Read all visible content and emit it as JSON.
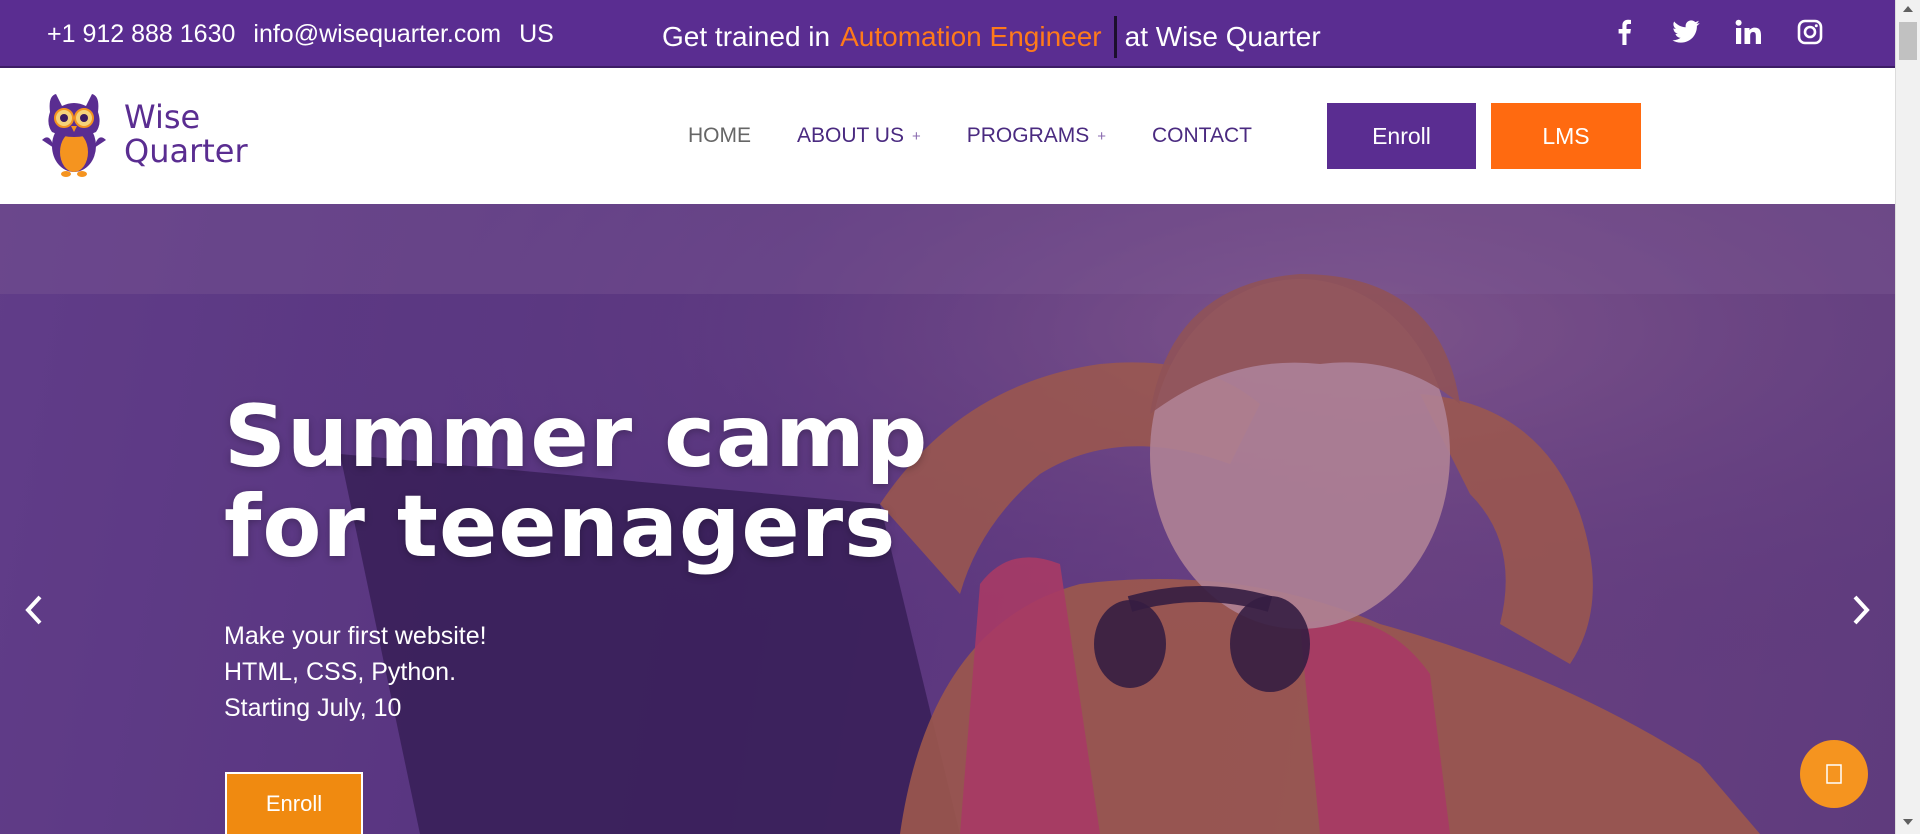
{
  "topbar": {
    "phone": "+1 912 888 1630",
    "email": "info@wisequarter.com",
    "region": "US",
    "promo_prefix": "Get trained in",
    "promo_highlight": "Automation Engineer",
    "promo_suffix": "at Wise Quarter",
    "highlight_color": "#ff7a1a",
    "social_icons": [
      "facebook-icon",
      "twitter-icon",
      "linkedin-icon",
      "instagram-icon"
    ]
  },
  "header": {
    "logo_line1": "Wise",
    "logo_line2": "Quarter",
    "nav": {
      "home": "HOME",
      "about": "ABOUT US",
      "programs": "PROGRAMS",
      "contact": "CONTACT",
      "expand_symbol": "+"
    },
    "enroll_label": "Enroll",
    "lms_label": "LMS"
  },
  "hero": {
    "title_line1": "Summer camp",
    "title_line2": "for teenagers",
    "sub_line1": "Make your first website!",
    "sub_line2": "HTML, CSS, Python.",
    "sub_line3": "Starting July, 10",
    "enroll_label": "Enroll"
  },
  "colors": {
    "brand_purple": "#5a2d91",
    "brand_orange": "#ff6a10",
    "chat_orange": "#f5941f"
  }
}
